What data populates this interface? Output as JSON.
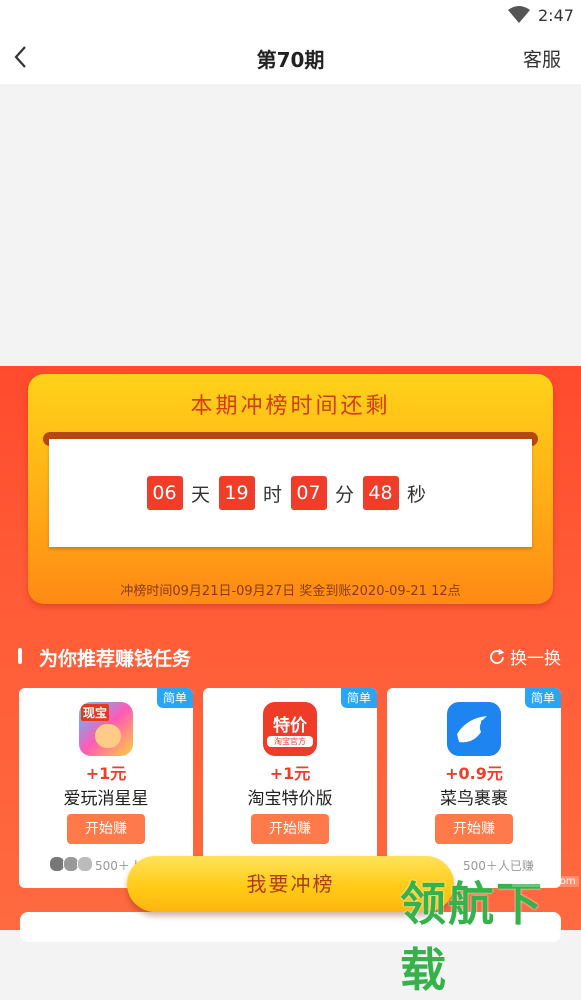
{
  "status_bar": {
    "time": "2:47"
  },
  "nav": {
    "title": "第70期",
    "service_label": "客服"
  },
  "countdown": {
    "title": "本期冲榜时间还剩",
    "days": "06",
    "day_unit": "天",
    "hours": "19",
    "hour_unit": "时",
    "minutes": "07",
    "minute_unit": "分",
    "seconds": "48",
    "second_unit": "秒",
    "note": "冲榜时间09月21日-09月27日 奖金到账2020-09-21 12点"
  },
  "section": {
    "title": "为你推荐赚钱任务",
    "refresh_label": "换一换"
  },
  "tasks": [
    {
      "badge": "简单",
      "reward": "+1元",
      "name": "爱玩消星星",
      "start_label": "开始赚",
      "icon": "star-game-icon",
      "icon_text": "现宝"
    },
    {
      "badge": "简单",
      "reward": "+1元",
      "name": "淘宝特价版",
      "start_label": "开始赚",
      "icon": "taobao-special-icon",
      "icon_text": "特价",
      "icon_sub": "淘宝官方"
    },
    {
      "badge": "简单",
      "reward": "+0.9元",
      "name": "菜鸟裹裹",
      "start_label": "开始赚",
      "icon": "cainiao-bird-icon",
      "joined": "500＋人已赚"
    }
  ],
  "first_task_joined": "500＋人",
  "cta_label": "我要冲榜",
  "watermark": {
    "logo": "领航下载",
    "url": "lhdown.com"
  },
  "colors": {
    "primary_red": "#ef3d2a",
    "background_red": "#ff5a36",
    "gold": "#ffc915",
    "badge_blue": "#2aa4f4"
  }
}
